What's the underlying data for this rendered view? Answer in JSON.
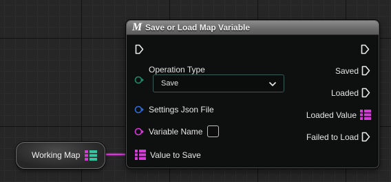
{
  "node": {
    "icon_letter": "M",
    "title": "Save or Load Map Variable",
    "inputs": {
      "operation_type_label": "Operation Type",
      "operation_type_value": "Save",
      "settings_json_label": "Settings Json File",
      "variable_name_label": "Variable Name",
      "value_to_save_label": "Value to Save"
    },
    "outputs": {
      "saved": "Saved",
      "loaded": "Loaded",
      "loaded_value": "Loaded Value",
      "failed_to_load": "Failed to Load"
    }
  },
  "working_map": {
    "label": "Working Map"
  },
  "colors": {
    "enum_pin": "#1f8a6b",
    "struct_pin": "#2f6cd8",
    "name_pin": "#d63ad8",
    "map_key": "#d63ad8",
    "map_value": "#36c4a2",
    "wire": "#d63ad8"
  }
}
